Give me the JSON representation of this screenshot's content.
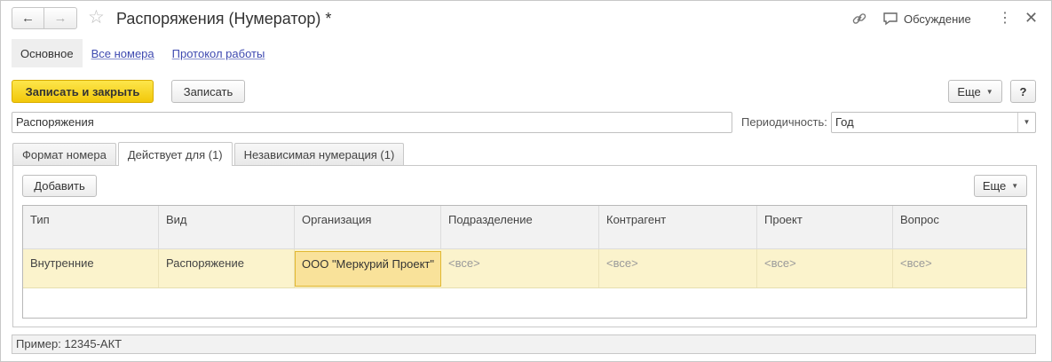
{
  "window": {
    "title": "Распоряжения (Нумератор) *",
    "discussion_label": "Обсуждение"
  },
  "form_nav": {
    "items": [
      {
        "label": "Основное"
      },
      {
        "label": "Все номера"
      },
      {
        "label": "Протокол работы"
      }
    ]
  },
  "toolbar": {
    "save_close_label": "Записать и закрыть",
    "save_label": "Записать",
    "more_label": "Еще",
    "help_label": "?"
  },
  "fields": {
    "name_value": "Распоряжения",
    "periodicity_label": "Периодичность:",
    "periodicity_value": "Год"
  },
  "tabs": [
    {
      "label": "Формат номера"
    },
    {
      "label": "Действует для (1)"
    },
    {
      "label": "Независимая нумерация (1)"
    }
  ],
  "table_toolbar": {
    "add_label": "Добавить",
    "more_label": "Еще"
  },
  "table": {
    "columns": [
      "Тип",
      "Вид",
      "Организация",
      "Подразделение",
      "Контрагент",
      "Проект",
      "Вопрос"
    ],
    "rows": [
      [
        "Внутренние",
        "Распоряжение",
        "ООО \"Меркурий Проект\"",
        "<все>",
        "<все>",
        "<все>",
        "<все>"
      ]
    ]
  },
  "footer": {
    "example_text": "Пример: 12345-АКТ"
  },
  "colors": {
    "accent_button": "#f5d21c",
    "selected_row": "#fbf3cc",
    "selected_cell": "#f9e29a",
    "link": "#3f4ab0"
  }
}
